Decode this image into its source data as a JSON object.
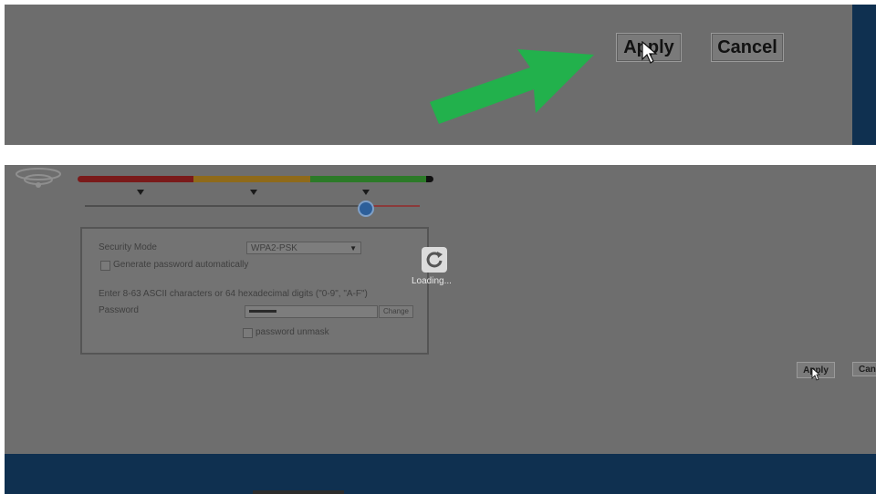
{
  "top_panel": {
    "apply_label": "Apply",
    "cancel_label": "Cancel",
    "background": "#6d6d6d",
    "accent_band": "#0f3050",
    "arrow_color": "#22b14c",
    "arrow_icon": "green-arrow-icon"
  },
  "bottom_panel": {
    "signal": {
      "icon": "wifi-icon",
      "segment_colors": [
        "#7a1a1a",
        "#8f6a1a",
        "#2c7a28"
      ]
    },
    "security": {
      "security_mode_label": "Security Mode",
      "security_mode_value": "WPA2-PSK",
      "generate_label": "Generate password automatically",
      "hint": "Enter 8-63 ASCII characters or 64 hexadecimal digits (\"0-9\", \"A-F\")",
      "password_label": "Password",
      "password_button": "Change",
      "unmask_label": "password unmask"
    },
    "loading_text": "Loading...",
    "apply_label": "Apply",
    "cancel_label": "Canc"
  },
  "footer": {
    "color": "#0f3050"
  }
}
